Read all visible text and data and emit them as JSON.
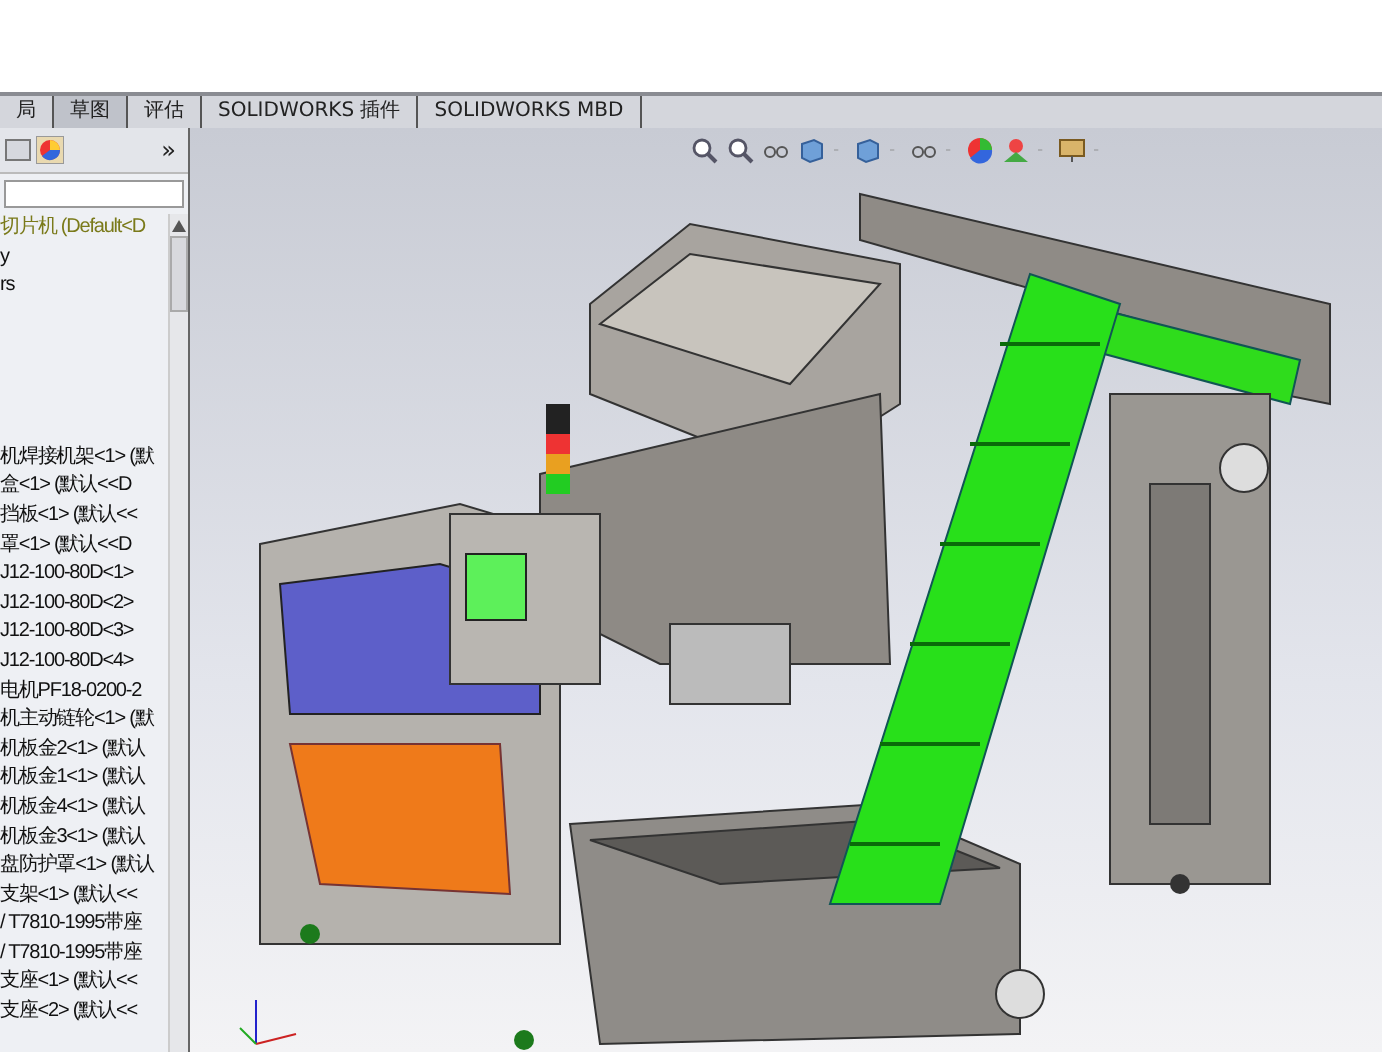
{
  "tabs": [
    {
      "label": "局",
      "selected": false
    },
    {
      "label": "草图",
      "selected": true
    },
    {
      "label": "评估",
      "selected": false
    },
    {
      "label": "SOLIDWORKS 插件",
      "selected": false
    },
    {
      "label": "SOLIDWORKS MBD",
      "selected": false
    }
  ],
  "panel": {
    "more": "»",
    "tree": {
      "label": "切片机 (Default<D",
      "children": [
        {
          "label": "y"
        },
        {
          "label": "rs"
        },
        {
          "label": "机焊接机架<1> (默"
        },
        {
          "label": "盒<1> (默认<<D"
        },
        {
          "label": "挡板<1> (默认<<"
        },
        {
          "label": "罩<1> (默认<<D"
        },
        {
          "label": "J12-100-80D<1>"
        },
        {
          "label": "J12-100-80D<2>"
        },
        {
          "label": "J12-100-80D<3>"
        },
        {
          "label": "J12-100-80D<4>"
        },
        {
          "label": "电机PF18-0200-2"
        },
        {
          "label": "机主动链轮<1> (默"
        },
        {
          "label": "机板金2<1> (默认"
        },
        {
          "label": "机板金1<1> (默认"
        },
        {
          "label": "机板金4<1> (默认"
        },
        {
          "label": "机板金3<1> (默认"
        },
        {
          "label": "盘防护罩<1> (默认"
        },
        {
          "label": "支架<1> (默认<<"
        },
        {
          "label": "/ T7810-1995带座"
        },
        {
          "label": "/ T7810-1995带座"
        },
        {
          "label": "支座<1> (默认<<"
        },
        {
          "label": "支座<2> (默认<<"
        }
      ]
    }
  }
}
